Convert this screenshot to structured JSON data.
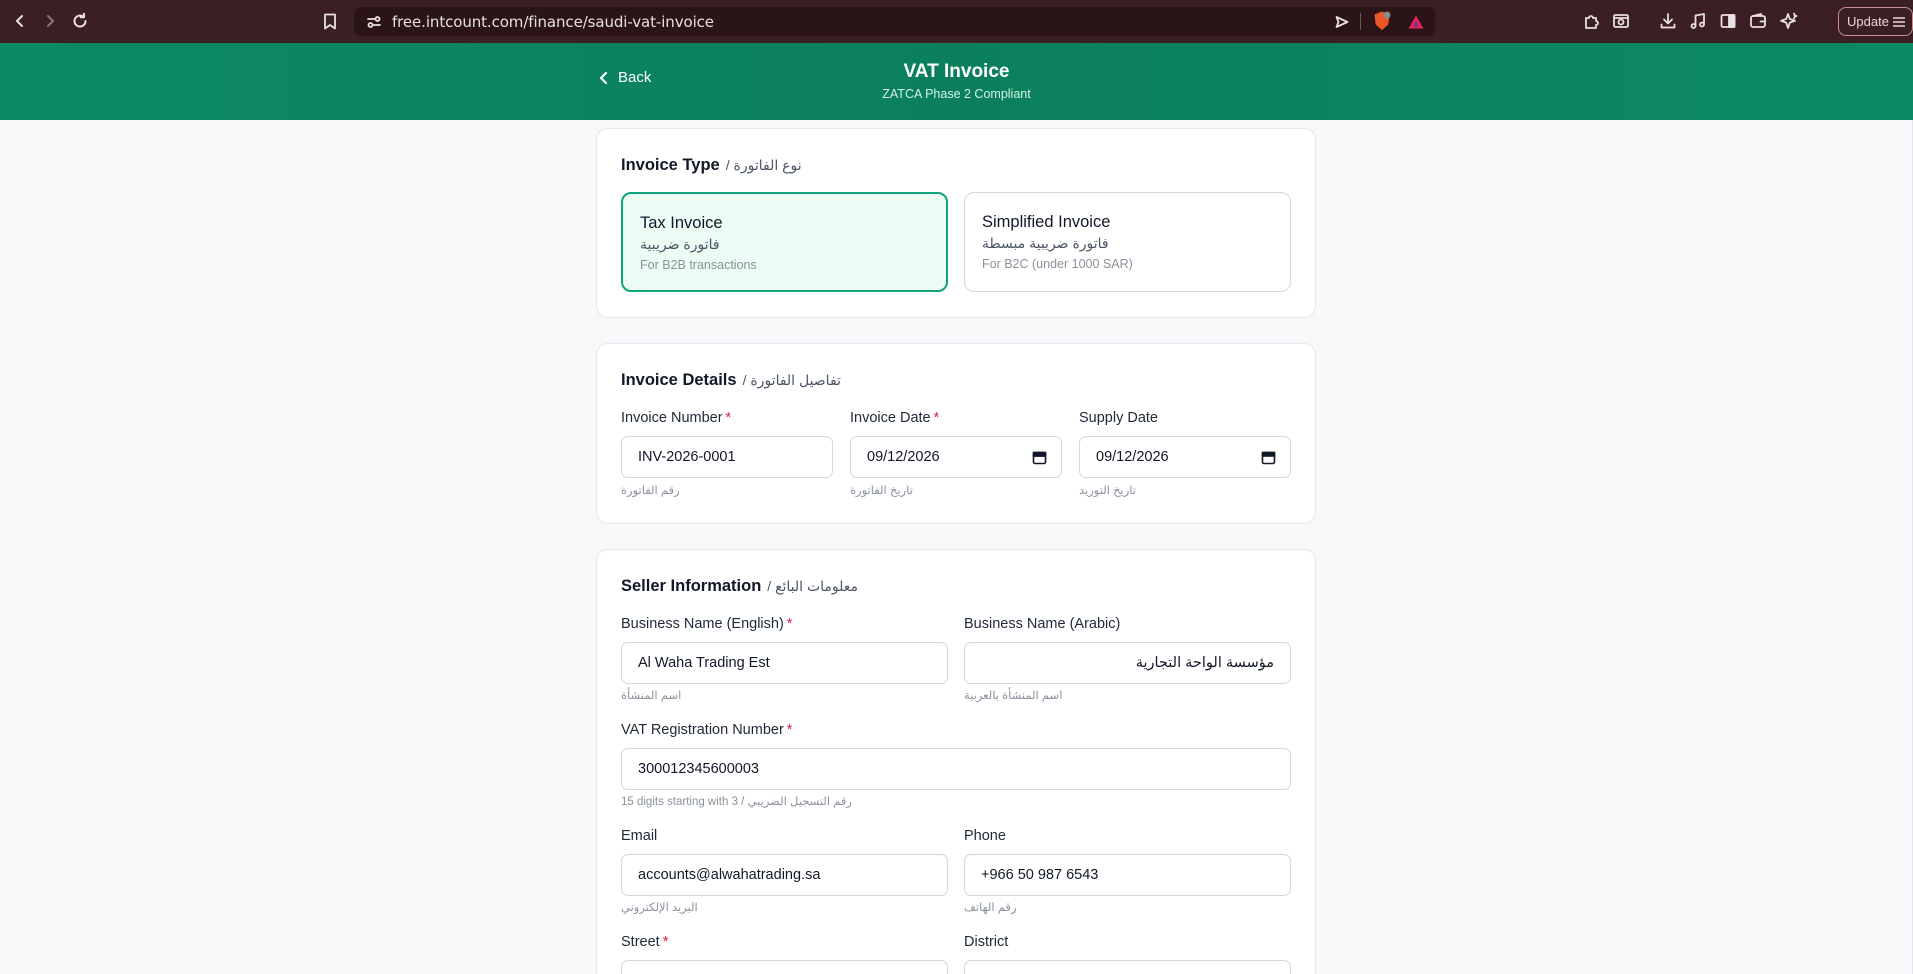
{
  "browser": {
    "url": "free.intcount.com/finance/saudi-vat-invoice",
    "update_label": "Update"
  },
  "header": {
    "back_label": "Back",
    "title": "VAT Invoice",
    "subtitle": "ZATCA Phase 2 Compliant"
  },
  "invoice_type": {
    "title": "Invoice Type",
    "title_ar": "/ نوع الفاتورة",
    "options": [
      {
        "title": "Tax Invoice",
        "title_ar": "فاتورة ضريبية",
        "desc": "For B2B transactions",
        "selected": true
      },
      {
        "title": "Simplified Invoice",
        "title_ar": "فاتورة ضريبية مبسطة",
        "desc": "For B2C (under 1000 SAR)",
        "selected": false
      }
    ]
  },
  "invoice_details": {
    "title": "Invoice Details",
    "title_ar": "/ تفاصيل الفاتورة",
    "number": {
      "label": "Invoice Number",
      "required": "*",
      "value": "INV-2026-0001",
      "hint": "رقم الفاتورة"
    },
    "date": {
      "label": "Invoice Date",
      "required": "*",
      "value": "09/12/2026",
      "hint": "تاريخ الفاتورة"
    },
    "supply": {
      "label": "Supply Date",
      "value": "09/12/2026",
      "hint": "تاريخ التوريد"
    }
  },
  "seller": {
    "title": "Seller Information",
    "title_ar": "/ معلومات البائع",
    "name_en": {
      "label": "Business Name (English)",
      "required": "*",
      "value": "Al Waha Trading Est",
      "hint": "اسم المنشأة"
    },
    "name_ar": {
      "label": "Business Name (Arabic)",
      "value": "مؤسسة الواحة التجارية",
      "hint": "اسم المنشأة بالعربية"
    },
    "vat": {
      "label": "VAT Registration Number",
      "required": "*",
      "value": "300012345600003",
      "hint": "15 digits starting with 3 / رقم التسجيل الضريبي"
    },
    "email": {
      "label": "Email",
      "value": "accounts@alwahatrading.sa",
      "hint": "البريد الإلكتروني"
    },
    "phone": {
      "label": "Phone",
      "value": "+966 50 987 6543",
      "hint": "رقم الهاتف"
    },
    "street": {
      "label": "Street",
      "required": "*"
    },
    "district": {
      "label": "District"
    }
  },
  "colors": {
    "brand": "#0c8a64",
    "selected_border": "#10a57a",
    "required": "#e11d48"
  }
}
